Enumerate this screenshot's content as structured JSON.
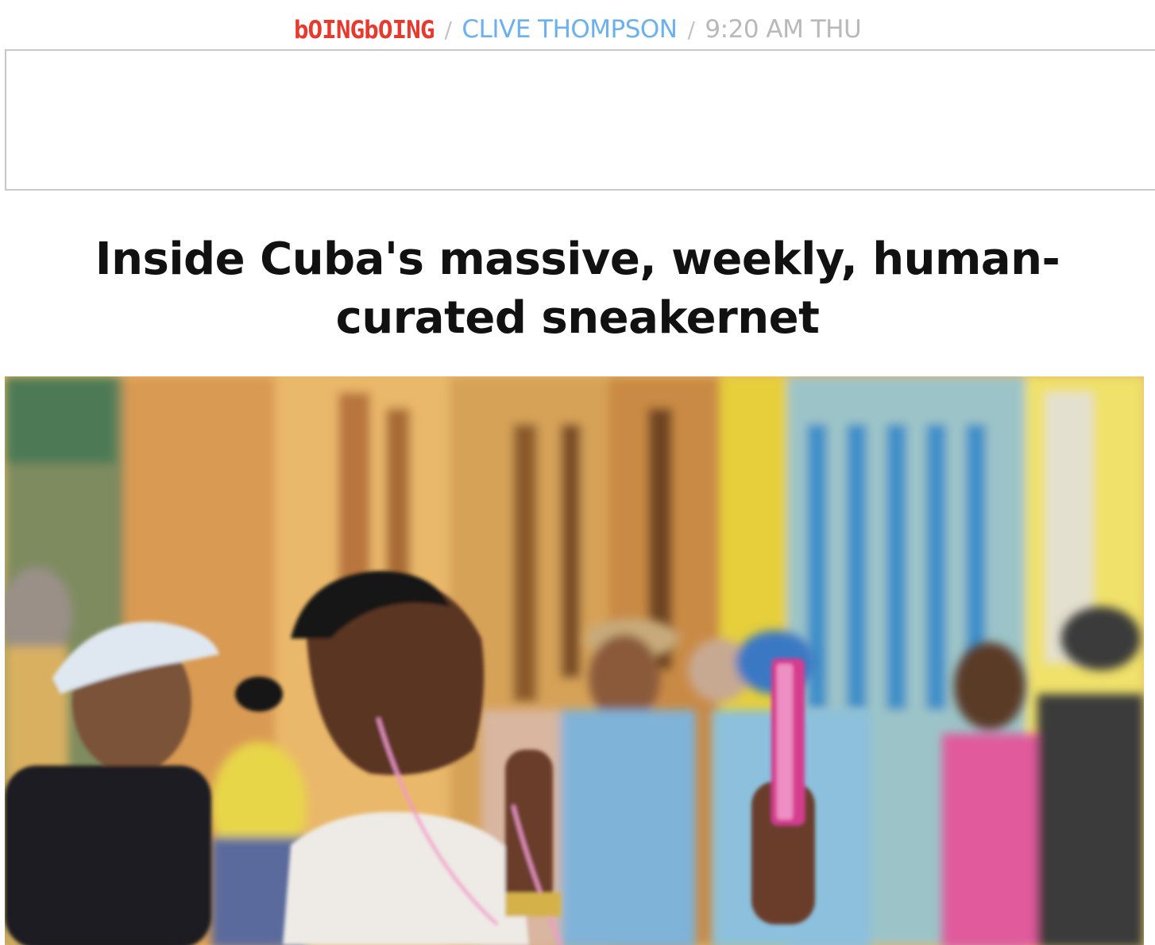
{
  "header": {
    "logo": "bOINGbOING",
    "separator": "/",
    "author": "CLIVE THOMPSON",
    "time": "9:20 AM THU"
  },
  "article": {
    "title": "Inside Cuba's massive, weekly, human-curated sneakernet"
  },
  "hero_image": {
    "subject": "woman-listening-to-phone-in-crowded-street"
  },
  "colors": {
    "logo": "#e8392f",
    "author": "#6cb1ee",
    "meta": "#b9b9b9",
    "title": "#111111",
    "ad_border": "#c8c8c8"
  }
}
